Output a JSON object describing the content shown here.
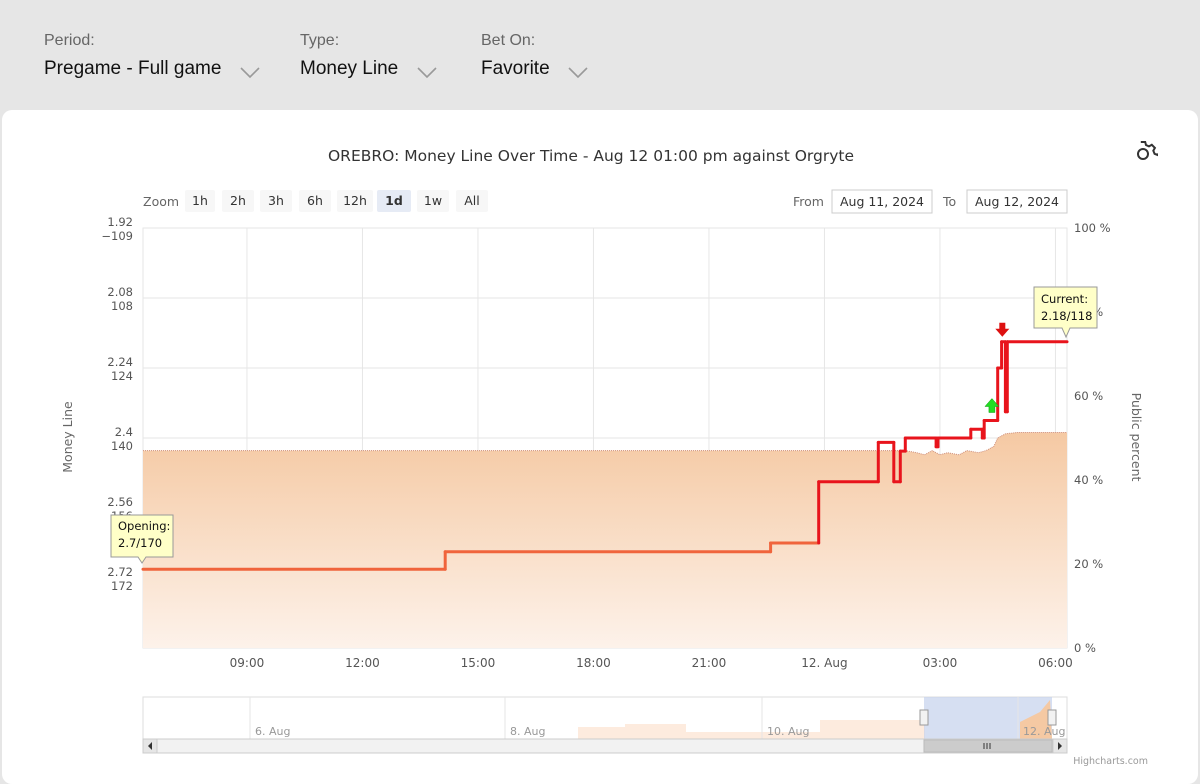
{
  "filters": {
    "period": {
      "label": "Period:",
      "value": "Pregame - Full game"
    },
    "type": {
      "label": "Type:",
      "value": "Money Line"
    },
    "bet_on": {
      "label": "Bet On:",
      "value": "Favorite"
    }
  },
  "icons": {
    "settings": "gear-icon",
    "dropdown": "chevron-down-icon",
    "up_marker": "green-up-arrow-icon",
    "down_marker": "red-down-arrow-icon"
  },
  "colors": {
    "line": "#e8141c",
    "opening_line": "#f0643c",
    "area_top": "#f5c9a3",
    "area_bottom": "#fdf2ea",
    "up_marker": "#22dd22",
    "down_marker": "#dd1111",
    "zoom_active_bg": "#e6ebf5",
    "navigator_mask": "#c5d1ec"
  },
  "zoom": {
    "label": "Zoom",
    "buttons": [
      "1h",
      "2h",
      "3h",
      "6h",
      "12h",
      "1d",
      "1w",
      "All"
    ],
    "active": "1d"
  },
  "range": {
    "from_label": "From",
    "from_value": "Aug 11, 2024",
    "to_label": "To",
    "to_value": "Aug 12, 2024"
  },
  "credit": "Highcharts.com",
  "chart_data": {
    "type": "line",
    "title": "OREBRO: Money Line Over Time - Aug 12 01:00 pm against Orgryte",
    "ylabel": "Money Line",
    "ylabel_right": "Public percent",
    "x_ticks": [
      "09:00",
      "12:00",
      "15:00",
      "18:00",
      "21:00",
      "12. Aug",
      "03:00",
      "06:00"
    ],
    "y_ticks_decimal": [
      "1.92",
      "2.08",
      "2.24",
      "2.4",
      "2.56",
      "2.72"
    ],
    "y_ticks_american": [
      "−109",
      "108",
      "124",
      "140",
      "156",
      "172"
    ],
    "ylim_decimal": [
      1.92,
      2.88
    ],
    "y_right_ticks": [
      "0 %",
      "20 %",
      "40 %",
      "60 %",
      "80 %",
      "100 %"
    ],
    "ylim_right": [
      0,
      100
    ],
    "xlim_hours": [
      6.3,
      30.3
    ],
    "series": [
      {
        "kind": "money_line",
        "points": [
          [
            6.3,
            2.7
          ],
          [
            14.15,
            2.7
          ],
          [
            14.15,
            2.66
          ],
          [
            22.6,
            2.66
          ],
          [
            22.6,
            2.64
          ],
          [
            23.85,
            2.64
          ],
          [
            23.85,
            2.5
          ],
          [
            25.4,
            2.5
          ],
          [
            25.4,
            2.41
          ],
          [
            25.8,
            2.41
          ],
          [
            25.8,
            2.5
          ],
          [
            25.97,
            2.5
          ],
          [
            25.97,
            2.43
          ],
          [
            26.1,
            2.43
          ],
          [
            26.1,
            2.4
          ],
          [
            26.9,
            2.4
          ],
          [
            26.9,
            2.42
          ],
          [
            26.95,
            2.42
          ],
          [
            26.95,
            2.4
          ],
          [
            27.8,
            2.4
          ],
          [
            27.8,
            2.38
          ],
          [
            28.1,
            2.38
          ],
          [
            28.1,
            2.4
          ],
          [
            28.15,
            2.4
          ],
          [
            28.15,
            2.36
          ],
          [
            28.5,
            2.36
          ],
          [
            28.5,
            2.24
          ],
          [
            28.6,
            2.24
          ],
          [
            28.6,
            2.18
          ],
          [
            28.7,
            2.18
          ],
          [
            28.7,
            2.34
          ],
          [
            28.75,
            2.34
          ],
          [
            28.75,
            2.18
          ],
          [
            30.3,
            2.18
          ]
        ]
      },
      {
        "kind": "public_percent",
        "points": [
          [
            6.3,
            47
          ],
          [
            26.1,
            47
          ],
          [
            26.4,
            46.5
          ],
          [
            26.6,
            46
          ],
          [
            26.8,
            47
          ],
          [
            27,
            46
          ],
          [
            27.2,
            46.5
          ],
          [
            27.5,
            46
          ],
          [
            27.7,
            47
          ],
          [
            28,
            46.5
          ],
          [
            28.2,
            47
          ],
          [
            28.4,
            48
          ],
          [
            28.5,
            50
          ],
          [
            28.7,
            51
          ],
          [
            29,
            51.3
          ],
          [
            30.3,
            51.3
          ]
        ]
      }
    ],
    "annotations": {
      "opening": {
        "title": "Opening:",
        "value": "2.7/170"
      },
      "current": {
        "title": "Current:",
        "value": "2.18/118"
      }
    },
    "navigator": {
      "labels": [
        "6. Aug",
        "8. Aug",
        "10. Aug",
        "12. Aug"
      ]
    }
  }
}
